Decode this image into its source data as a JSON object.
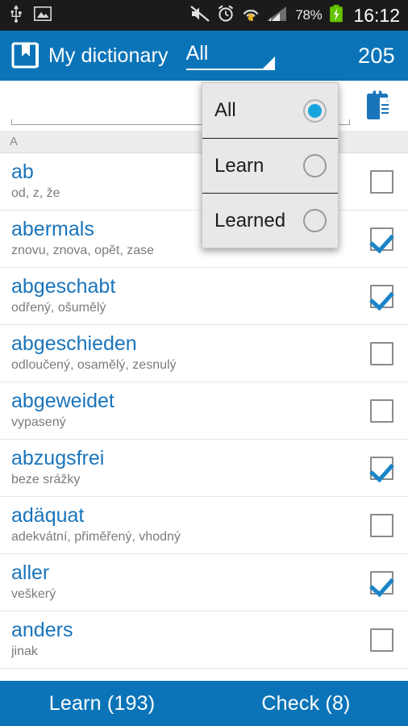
{
  "statusbar": {
    "icons_left": [
      "usb-icon",
      "image-icon"
    ],
    "icons_right": [
      "mute-icon",
      "alarm-icon",
      "wifi-transfer-icon",
      "signal-icon"
    ],
    "battery_percent": "78%",
    "battery_icon": "battery-charging-icon",
    "clock": "16:12"
  },
  "appbar": {
    "logo_icon": "dictionary-book-icon",
    "title": "My dictionary",
    "spinner_value": "All",
    "spinner_caret_icon": "spinner-caret-icon",
    "count": "205"
  },
  "search": {
    "value": "",
    "placeholder": "",
    "clipboard_icon": "clipboard-paste-icon"
  },
  "section": {
    "header": "A"
  },
  "list": {
    "items": [
      {
        "term": "ab",
        "translation": "od, z, že",
        "checked": false
      },
      {
        "term": "abermals",
        "translation": "znovu, znova, opět, zase",
        "checked": true
      },
      {
        "term": "abgeschabt",
        "translation": "odřený, ošumělý",
        "checked": true
      },
      {
        "term": "abgeschieden",
        "translation": "odloučený, osamělý, zesnulý",
        "checked": false
      },
      {
        "term": "abgeweidet",
        "translation": "vypasený",
        "checked": false
      },
      {
        "term": "abzugsfrei",
        "translation": "beze srážky",
        "checked": true
      },
      {
        "term": "adäquat",
        "translation": "adekvátní, přiměřený, vhodný",
        "checked": false
      },
      {
        "term": "aller",
        "translation": "veškerý",
        "checked": true
      },
      {
        "term": "anders",
        "translation": "jinak",
        "checked": false
      }
    ]
  },
  "dropdown": {
    "visible": true,
    "options": [
      {
        "label": "All",
        "selected": true
      },
      {
        "label": "Learn",
        "selected": false
      },
      {
        "label": "Learned",
        "selected": false
      }
    ]
  },
  "bottombar": {
    "learn_label": "Learn (193)",
    "check_label": "Check (8)"
  },
  "colors": {
    "accent": "#0b74b8",
    "term": "#1a74ba",
    "checkbox_check": "#1a84c8",
    "radio_selected": "#18a3dd",
    "statusbar_bg": "#1b1b1b"
  }
}
